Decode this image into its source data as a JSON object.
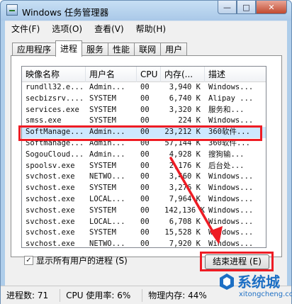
{
  "window": {
    "title": "Windows 任务管理器",
    "min_glyph": "—",
    "max_glyph": "□",
    "close_glyph": "✕",
    "icon": "task-manager-icon"
  },
  "menu": [
    "文件(F)",
    "选项(O)",
    "查看(V)",
    "帮助(H)"
  ],
  "tabs": [
    "应用程序",
    "进程",
    "服务",
    "性能",
    "联网",
    "用户"
  ],
  "active_tab": "进程",
  "columns": [
    "映像名称",
    "用户名",
    "CPU",
    "内存(...",
    "描述"
  ],
  "rows": [
    [
      "rundll32.e...",
      "Admin...",
      "00",
      "3,940 K",
      "Windows..."
    ],
    [
      "secbizsrv....",
      "SYSTEM",
      "00",
      "6,740 K",
      "Alipay ..."
    ],
    [
      "services.exe",
      "SYSTEM",
      "00",
      "3,320 K",
      "服务和..."
    ],
    [
      "smss.exe",
      "SYSTEM",
      "00",
      "224 K",
      "Windows..."
    ],
    [
      "SoftManage...",
      "Admin...",
      "00",
      "23,212 K",
      "360软件..."
    ],
    [
      "Softmanage...",
      "Admin...",
      "00",
      "57,144 K",
      "360软件..."
    ],
    [
      "SogouCloud...",
      "Admin...",
      "00",
      "4,928 K",
      "搜狗输..."
    ],
    [
      "spoolsv.exe",
      "SYSTEM",
      "00",
      "2,176 K",
      "后台处..."
    ],
    [
      "svchost.exe",
      "NETWO...",
      "00",
      "3,460 K",
      "Windows..."
    ],
    [
      "svchost.exe",
      "SYSTEM",
      "00",
      "3,276 K",
      "Windows..."
    ],
    [
      "svchost.exe",
      "LOCAL...",
      "00",
      "7,964 K",
      "Windows..."
    ],
    [
      "svchost.exe",
      "SYSTEM",
      "00",
      "142,136 K",
      "Windows..."
    ],
    [
      "svchost.exe",
      "LOCAL...",
      "00",
      "6,708 K",
      "Windows..."
    ],
    [
      "svchost.exe",
      "SYSTEM",
      "00",
      "15,528 K",
      "Windows..."
    ],
    [
      "svchost.exe",
      "NETWO...",
      "00",
      "7,920 K",
      "Windows..."
    ]
  ],
  "selected_row_index": 4,
  "show_all_users": {
    "checked_glyph": "✓",
    "label": "显示所有用户的进程 (S)"
  },
  "end_process_label": "结束进程 (E)",
  "status": {
    "processes": "进程数: 71",
    "cpu": "CPU 使用率: 6%",
    "memory": "物理内存: 44%"
  },
  "watermark": {
    "title": "系统城",
    "site": "xitongcheng.com"
  },
  "colors": {
    "highlight_red": "#ee1c24",
    "selected_row": "#cde8ff",
    "brand_blue": "#1d6fc4"
  }
}
